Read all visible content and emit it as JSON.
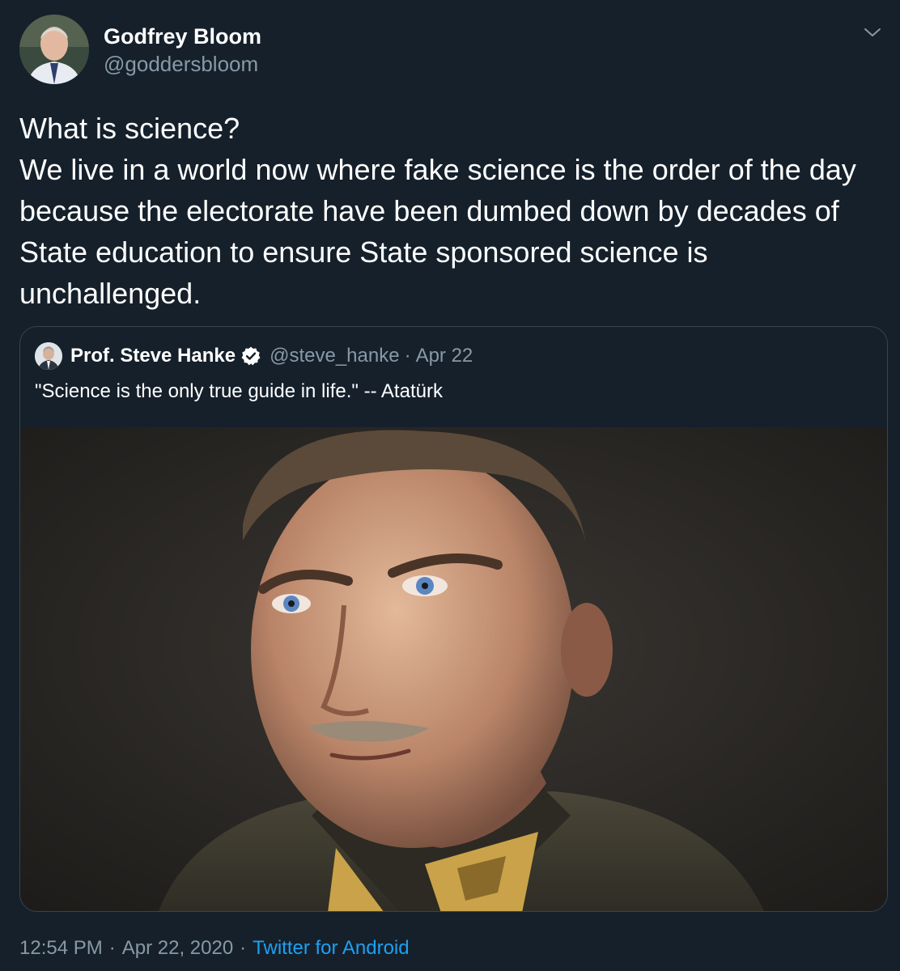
{
  "author": {
    "display_name": "Godfrey Bloom",
    "handle": "@goddersbloom"
  },
  "tweet": {
    "text": "What is science?\nWe live in a world now where fake science is the order of the day because the electorate have been dumbed down by decades of State education to ensure State sponsored science is unchallenged."
  },
  "quoted_tweet": {
    "display_name": "Prof. Steve Hanke",
    "verified": true,
    "handle": "@steve_hanke",
    "separator": "·",
    "date": "Apr 22",
    "text": "\"Science is the only true guide in life.\" -- Atatürk",
    "media": "portrait-photo"
  },
  "footer": {
    "time": "12:54 PM",
    "separator": "·",
    "date": "Apr 22, 2020",
    "source": "Twitter for Android"
  },
  "icons": {
    "menu": "chevron-down-icon",
    "verified": "verified-badge-icon"
  },
  "colors": {
    "background": "#15202b",
    "secondary_text": "#8899a6",
    "accent": "#1da1f2",
    "border": "#38444d"
  }
}
